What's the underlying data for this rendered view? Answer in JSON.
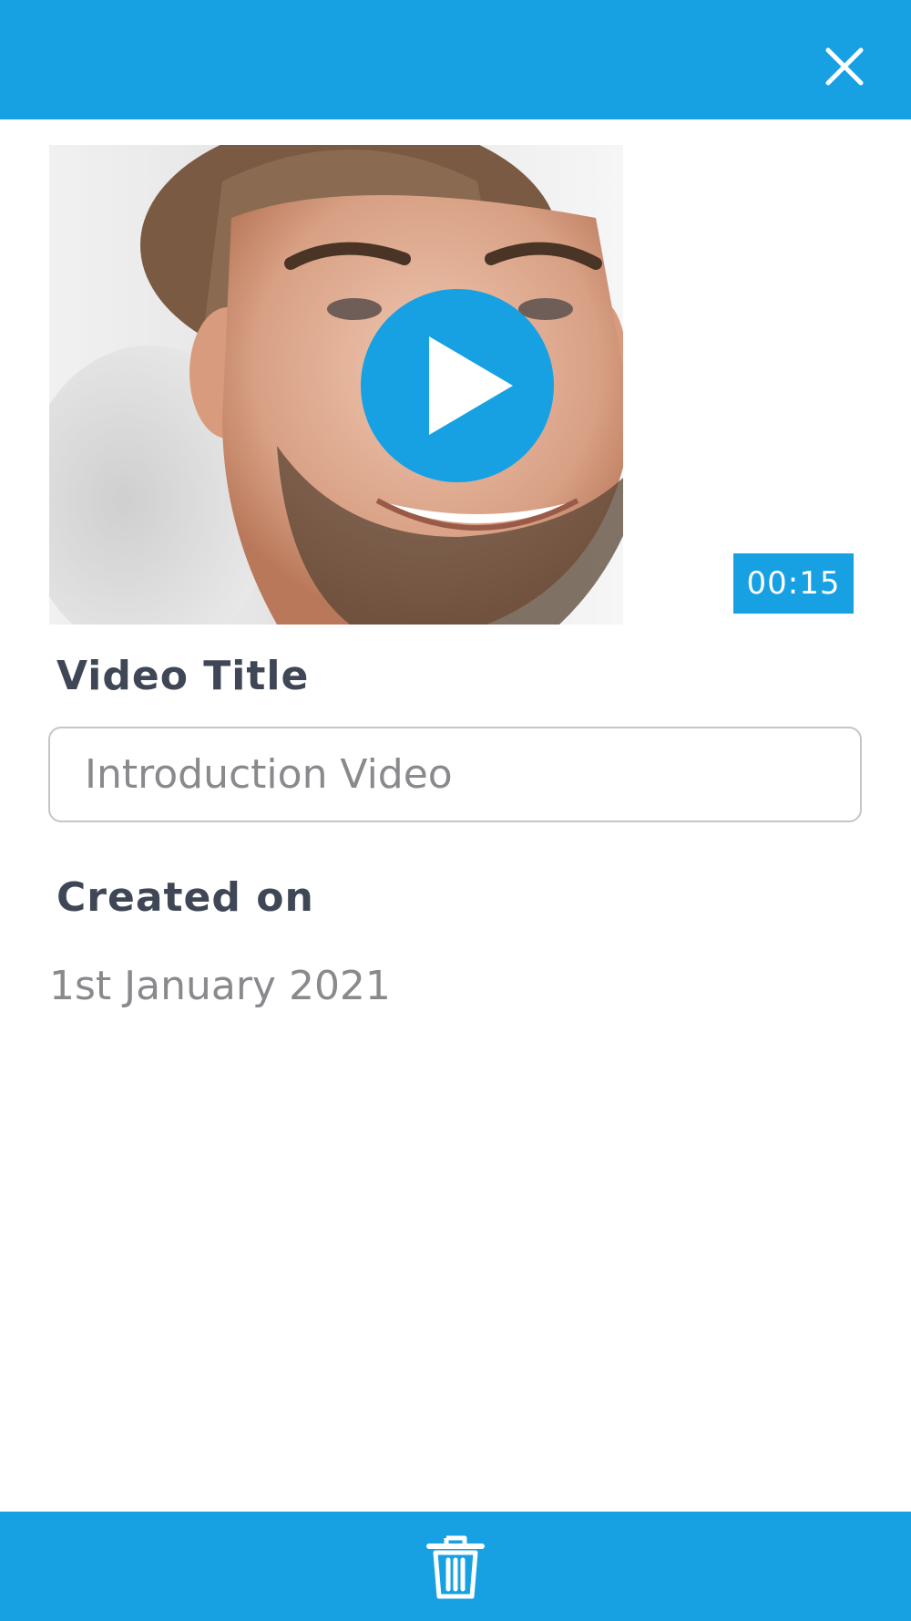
{
  "colors": {
    "accent": "#17a1e2",
    "label_text": "#3f4756",
    "muted_text": "#8a8a8e",
    "background": "#ffffff"
  },
  "header": {
    "close_icon": "close-icon"
  },
  "video": {
    "thumbnail": "smiling-man-photo",
    "play_icon": "play-icon",
    "duration": "00:15"
  },
  "form": {
    "title_label": "Video Title",
    "title_value": "Introduction Video",
    "created_label": "Created on",
    "created_value": "1st January 2021"
  },
  "footer": {
    "delete_icon": "trash-icon"
  }
}
